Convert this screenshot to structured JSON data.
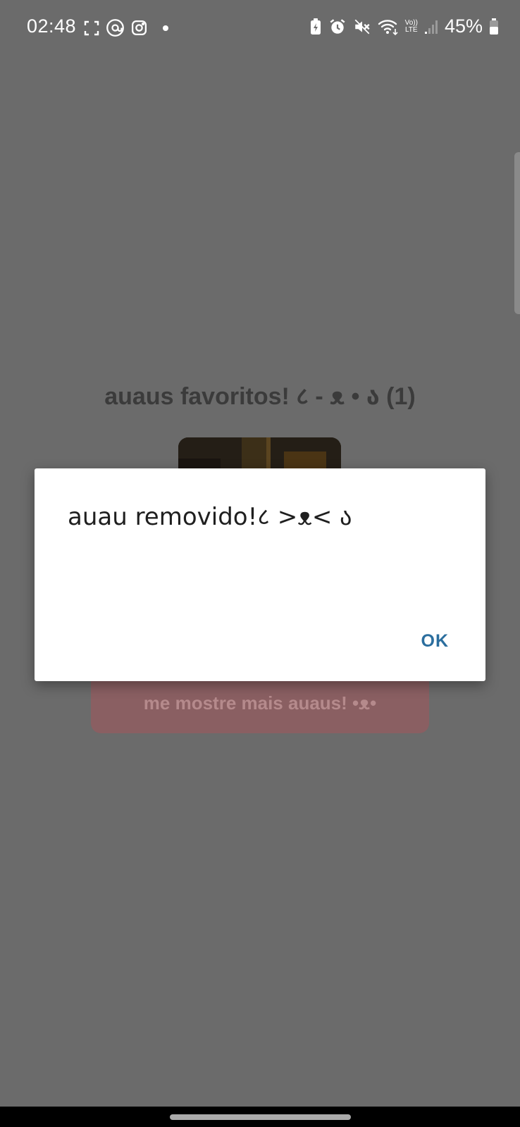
{
  "status_bar": {
    "time": "02:48",
    "battery_percent": "45%",
    "left_icons": [
      "screenshot-icon",
      "threads-icon",
      "instagram-icon",
      "notification-dot-icon"
    ],
    "right_icons": [
      "battery-saver-icon",
      "alarm-icon",
      "mute-icon",
      "wifi-icon",
      "volte-lte-icon",
      "signal-icon",
      "battery-icon"
    ],
    "volte_label_top": "Vo))",
    "volte_label_bottom": "LTE"
  },
  "page": {
    "title": "auaus favoritos! ८ - ᴥ • ა (1)",
    "more_button_label": "me mostre mais auaus! •ᴥ•"
  },
  "dialog": {
    "message": "auau removido!८ >ᴥ< ა",
    "ok_label": "OK"
  },
  "colors": {
    "scrim": "#6b6b6b",
    "dialog_bg": "#ffffff",
    "ok_accent": "#2b6e9e",
    "button_bg_dimmed": "#8a5f62"
  }
}
